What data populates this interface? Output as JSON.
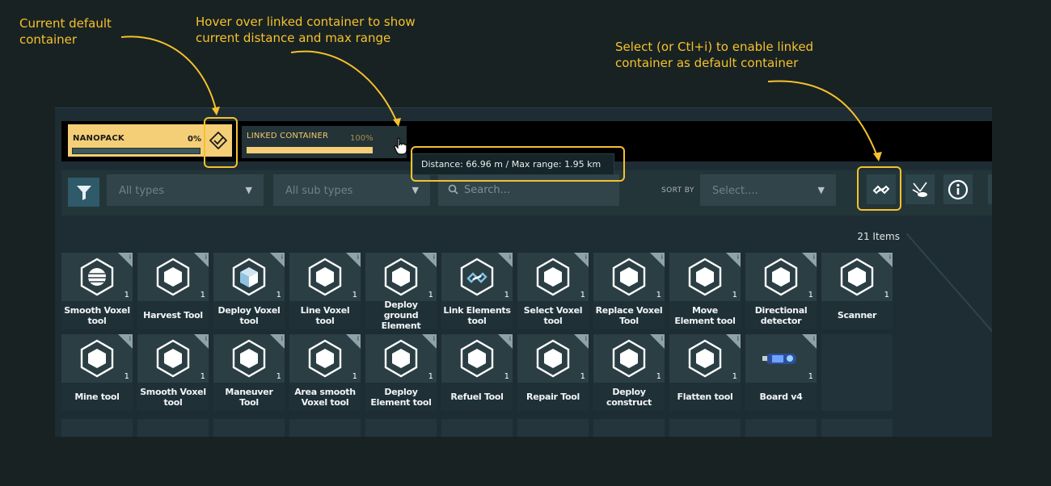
{
  "annotations": {
    "current_default": "Current default container",
    "hover_linked": "Hover over linked container to show current distance and max range",
    "select_enable": "Select (or Ctl+i) to enable linked container as default container",
    "color": "#f6c12d"
  },
  "containers": {
    "nanopack": {
      "label": "NANOPACK",
      "percent": "0%",
      "fill": 0
    },
    "linked": {
      "label": "LINKED CONTAINER",
      "percent": "100%",
      "fill": 1
    }
  },
  "tooltip": {
    "text": "Distance: 66.96 m / Max range: 1.95 km"
  },
  "filters": {
    "types_placeholder": "All types",
    "subtypes_placeholder": "All sub types",
    "search_placeholder": "Search...",
    "sort_label": "SORT BY",
    "sort_placeholder": "Select...."
  },
  "items_count": "21 Items",
  "items": [
    {
      "name": "Smooth Voxel tool",
      "qty": "1",
      "icon": "sphere-icon"
    },
    {
      "name": "Harvest Tool",
      "qty": "1",
      "icon": "harvest-icon"
    },
    {
      "name": "Deploy Voxel tool",
      "qty": "1",
      "icon": "cube-icon"
    },
    {
      "name": "Line Voxel tool",
      "qty": "1",
      "icon": "line-voxel-icon"
    },
    {
      "name": "Deploy ground Element",
      "qty": "1",
      "icon": "ground-element-icon"
    },
    {
      "name": "Link Elements tool",
      "qty": "1",
      "icon": "link-icon"
    },
    {
      "name": "Select Voxel tool",
      "qty": "1",
      "icon": "select-voxel-icon"
    },
    {
      "name": "Replace Voxel Tool",
      "qty": "1",
      "icon": "replace-voxel-icon"
    },
    {
      "name": "Move Element tool",
      "qty": "1",
      "icon": "move-element-icon"
    },
    {
      "name": "Directional detector",
      "qty": "1",
      "icon": "detector-icon"
    },
    {
      "name": "Scanner",
      "qty": "1",
      "icon": "scanner-icon"
    },
    {
      "name": "Mine tool",
      "qty": "1",
      "icon": "crystal-icon"
    },
    {
      "name": "Smooth Voxel tool",
      "qty": "1",
      "icon": "smooth-cube-icon"
    },
    {
      "name": "Maneuver Tool",
      "qty": "1",
      "icon": "maneuver-icon"
    },
    {
      "name": "Area smooth Voxel tool",
      "qty": "1",
      "icon": "area-smooth-icon"
    },
    {
      "name": "Deploy Element tool",
      "qty": "1",
      "icon": "deploy-element-icon"
    },
    {
      "name": "Refuel Tool",
      "qty": "1",
      "icon": "fuel-icon"
    },
    {
      "name": "Repair Tool",
      "qty": "1",
      "icon": "repair-icon"
    },
    {
      "name": "Deploy construct",
      "qty": "1",
      "icon": "deploy-construct-icon"
    },
    {
      "name": "Flatten tool",
      "qty": "1",
      "icon": "flatten-icon"
    },
    {
      "name": "Board v4",
      "qty": "1",
      "icon": "board-icon"
    }
  ]
}
